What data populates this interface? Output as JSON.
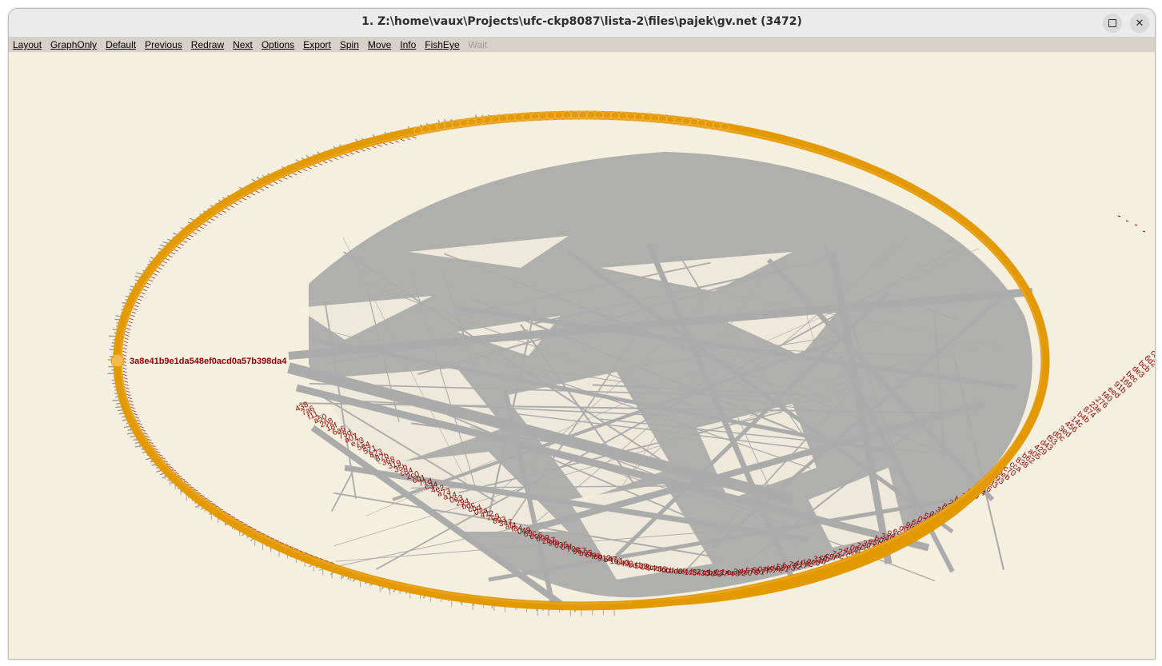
{
  "window": {
    "title": "1. Z:\\home\\vaux\\Projects\\ufc-ckp8087\\lista-2\\files\\pajek\\gv.net (3472)",
    "maximize_icon": "maximize-square-icon",
    "close_icon": "close-x-icon"
  },
  "menu": {
    "items": [
      {
        "label": "Layout",
        "enabled": true
      },
      {
        "label": "GraphOnly",
        "enabled": true
      },
      {
        "label": "Default",
        "enabled": true
      },
      {
        "label": "Previous",
        "enabled": true
      },
      {
        "label": "Redraw",
        "enabled": true
      },
      {
        "label": "Next",
        "enabled": true
      },
      {
        "label": "Options",
        "enabled": true
      },
      {
        "label": "Export",
        "enabled": true
      },
      {
        "label": "Spin",
        "enabled": true
      },
      {
        "label": "Move",
        "enabled": true
      },
      {
        "label": "Info",
        "enabled": true
      },
      {
        "label": "FishEye",
        "enabled": true
      },
      {
        "label": "Wait",
        "enabled": false
      }
    ]
  },
  "graph": {
    "highlighted_vertex_label": "3a8e41b9e1da548ef0acd0a57b398da4",
    "colors": {
      "background": "#f5efdf",
      "vertex": "#e39a00",
      "highlighted_vertex": "#f3bb4e",
      "edge": "#ababab",
      "label": "#8b0000"
    }
  }
}
